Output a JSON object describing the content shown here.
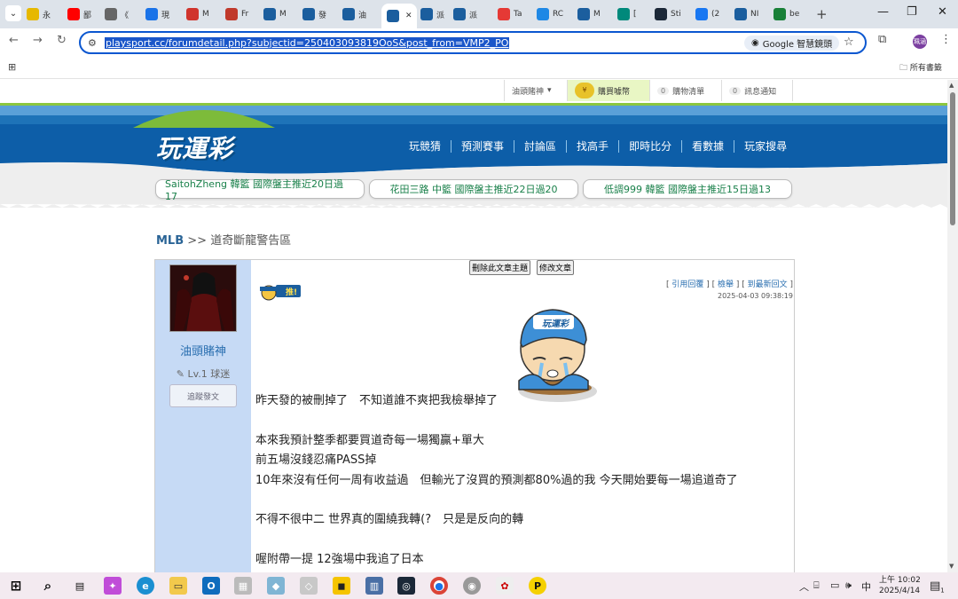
{
  "browser": {
    "tabs": [
      {
        "label": "永",
        "icon": "lottery-icon",
        "color": "#e6b800"
      },
      {
        "label": "鄙",
        "icon": "youtube-icon",
        "color": "#ff0000"
      },
      {
        "label": "《",
        "icon": "document-icon",
        "color": "#666666"
      },
      {
        "label": "現",
        "icon": "site-icon",
        "color": "#1a73e8"
      },
      {
        "label": "M",
        "icon": "chat-icon",
        "color": "#d0342c"
      },
      {
        "label": "Fr",
        "icon": "store-icon",
        "color": "#c0392b"
      },
      {
        "label": "M",
        "icon": "playsport-icon",
        "color": "#1b5e9e"
      },
      {
        "label": "發",
        "icon": "playsport-icon",
        "color": "#1b5e9e"
      },
      {
        "label": "油",
        "icon": "playsport-icon",
        "color": "#1b5e9e"
      },
      {
        "label": "",
        "icon": "playsport-icon",
        "color": "#1b5e9e",
        "active": true
      },
      {
        "label": "派",
        "icon": "playsport-icon",
        "color": "#1b5e9e"
      },
      {
        "label": "派",
        "icon": "playsport-icon",
        "color": "#1b5e9e"
      },
      {
        "label": "Ta",
        "icon": "red-circle-icon",
        "color": "#e53935"
      },
      {
        "label": "RC",
        "icon": "rc-icon",
        "color": "#1e88e5"
      },
      {
        "label": "M",
        "icon": "playsport-icon",
        "color": "#1b5e9e"
      },
      {
        "label": "[",
        "icon": "help-icon",
        "color": "#00897b"
      },
      {
        "label": "Sti",
        "icon": "steam-icon",
        "color": "#1b2838"
      },
      {
        "label": "(2",
        "icon": "facebook-icon",
        "color": "#1877f2"
      },
      {
        "label": "NI",
        "icon": "playsport-icon",
        "color": "#1b5e9e"
      },
      {
        "label": "be",
        "icon": "sheet-icon",
        "color": "#188038"
      }
    ],
    "url": "playsport.cc/forumdetail.php?subjectid=250403093819OoS&post_from=VMP2_PO",
    "lens_label": "Google 智慧鏡頭",
    "all_bookmarks": "所有書籤",
    "profile_initials": "珮涵"
  },
  "site": {
    "topbar": {
      "user_menu": "油頭賭神",
      "buy_predictions": "購買噱幣",
      "purchase_list": "購物清單",
      "purchase_count": "0",
      "notifications": "訊息通知",
      "notification_count": "0"
    },
    "logo": "玩運彩",
    "nav": [
      "玩競猜",
      "預測賽事",
      "討論區",
      "找高手",
      "即時比分",
      "看數據",
      "玩家搜尋"
    ],
    "tickers": [
      "SaitohZheng  韓籃  國際盤主推近20日過17",
      "花田三路  中籃  國際盤主推近22日過20",
      "低調999  韓籃  國際盤主推近15日過13"
    ],
    "breadcrumb": {
      "section": "MLB",
      "sep": ">>",
      "forum": "道奇斷龍警告區"
    }
  },
  "post": {
    "author": "油頭賭神",
    "level": "Lv.1 球迷",
    "follow_label": "追蹤發文",
    "delete_label": "刪除此文章主題",
    "edit_label": "修改文章",
    "quote_label": "引用回覆",
    "report_label": "檢舉",
    "latest_label": "到最新回文",
    "date": "2025-04-03 09:38:19",
    "push_label": "推!",
    "mascot_label": "玩運彩",
    "body": [
      "昨天發的被刪掉了　不知道誰不爽把我檢舉掉了",
      "",
      "本來我預計整季都要買道奇每一場獨贏+單大",
      "前五場沒錢忍痛PASS掉",
      "10年來沒有任何一周有收益過　但輸光了沒買的預測都80%過的我 今天開始要每一場追道奇了",
      "",
      "不得不很中二 世界真的圍繞我轉(?　只是是反向的轉",
      "",
      "喔附帶一提 12強場中我追了日本"
    ]
  },
  "taskbar": {
    "time": "上午 10:02",
    "date": "2025/4/14",
    "ime": "中",
    "notification_count": "1"
  }
}
